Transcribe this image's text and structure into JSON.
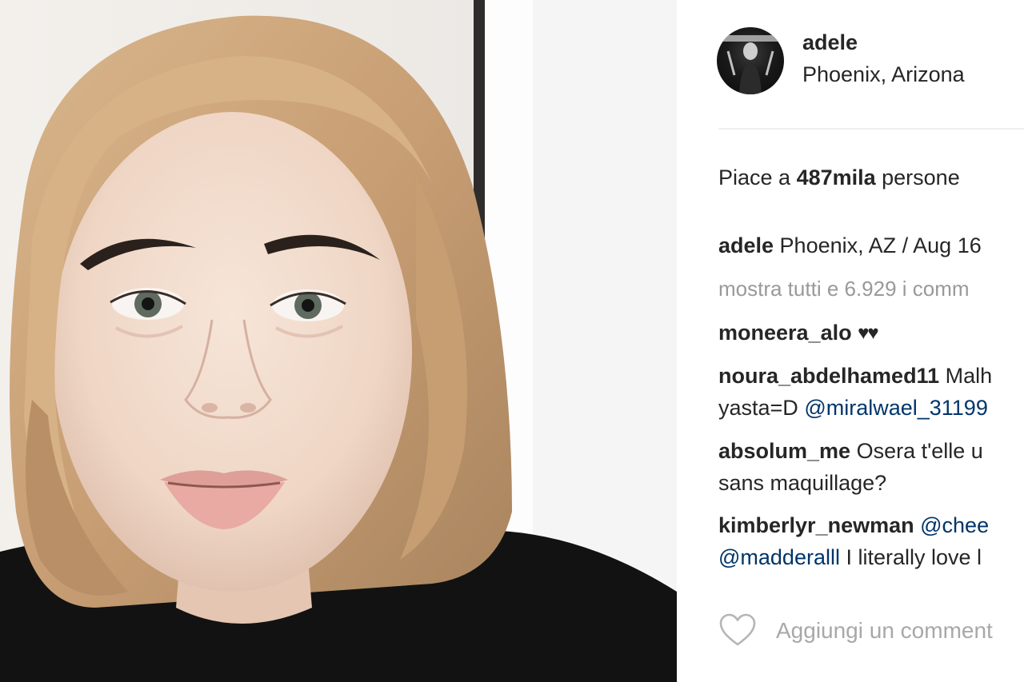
{
  "post": {
    "username": "adele",
    "location": "Phoenix, Arizona",
    "likes": {
      "prefix": "Piace a ",
      "count": "487mila",
      "suffix": " persone"
    },
    "caption": {
      "username": "adele",
      "text": " Phoenix, AZ / Aug 16"
    },
    "show_all_comments": "mostra tutti e 6.929 i comm"
  },
  "comments": [
    {
      "username": "moneera_alo",
      "text": " ",
      "emoji": "♥♥"
    },
    {
      "username": "noura_abdelhamed11",
      "text": " Malh",
      "line2": "yasta=D ",
      "mention": "@miralwael_31199"
    },
    {
      "username": "absolum_me",
      "text": " Osera t'elle u",
      "line2": "sans maquillage?"
    },
    {
      "username": "kimberlyr_newman",
      "text": " ",
      "mention": "@chee",
      "line2_mention": "@madderalll",
      "line2": " I literally love l"
    }
  ],
  "add_comment": {
    "placeholder": "Aggiungi un comment"
  },
  "icons": {
    "like": "heart-outline-icon"
  },
  "colors": {
    "text": "#262626",
    "muted": "#999999",
    "mention": "#003569"
  }
}
